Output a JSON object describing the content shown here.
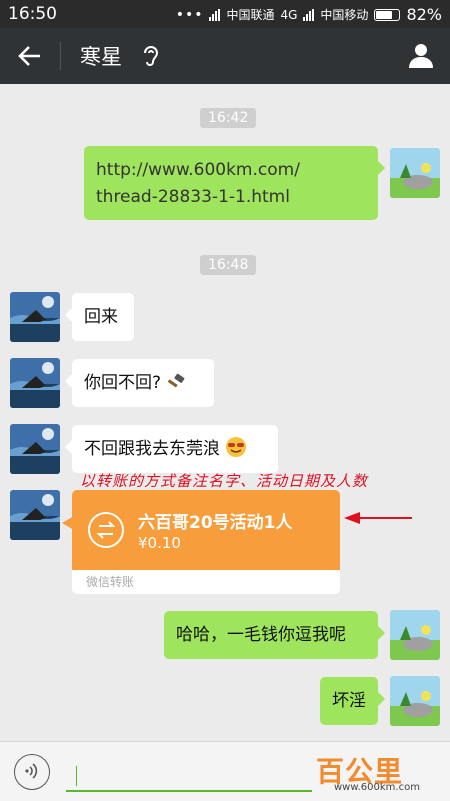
{
  "statusbar": {
    "time": "16:50",
    "dots": "•••",
    "carrier1": "中国联通",
    "network": "4G",
    "carrier2": "中国移动",
    "battery": "82%",
    "battery_level": 0.82
  },
  "header": {
    "title": "寒星",
    "back_icon": "arrow-left-icon",
    "earpiece_icon": "earpiece-icon",
    "profile_icon": "profile-icon"
  },
  "messages": {
    "time1": "16:42",
    "msg1_line1": "http://www.600km.com/",
    "msg1_line2": "thread-28833-1-1.html",
    "time2": "16:48",
    "msg2": "回来",
    "msg3": "你回不回?",
    "msg4": "不回跟我去东莞浪",
    "transfer": {
      "title": "六百哥20号活动1人",
      "amount": "¥0.10",
      "label": "微信转账"
    },
    "msg5": "哈哈，一毛钱你逗我呢",
    "msg6": "坏淫"
  },
  "annotation": "以转账的方式备注名字、活动日期及人数",
  "input": {
    "voice_icon": "voice-icon"
  },
  "watermark": {
    "brand": "百公里",
    "url": "www.600km.com"
  },
  "colors": {
    "header_bg": "#303336",
    "sent_bubble": "#9fe45d",
    "transfer_orange": "#f79d3c",
    "annotation_red": "#e01020",
    "background": "#ebebeb"
  }
}
